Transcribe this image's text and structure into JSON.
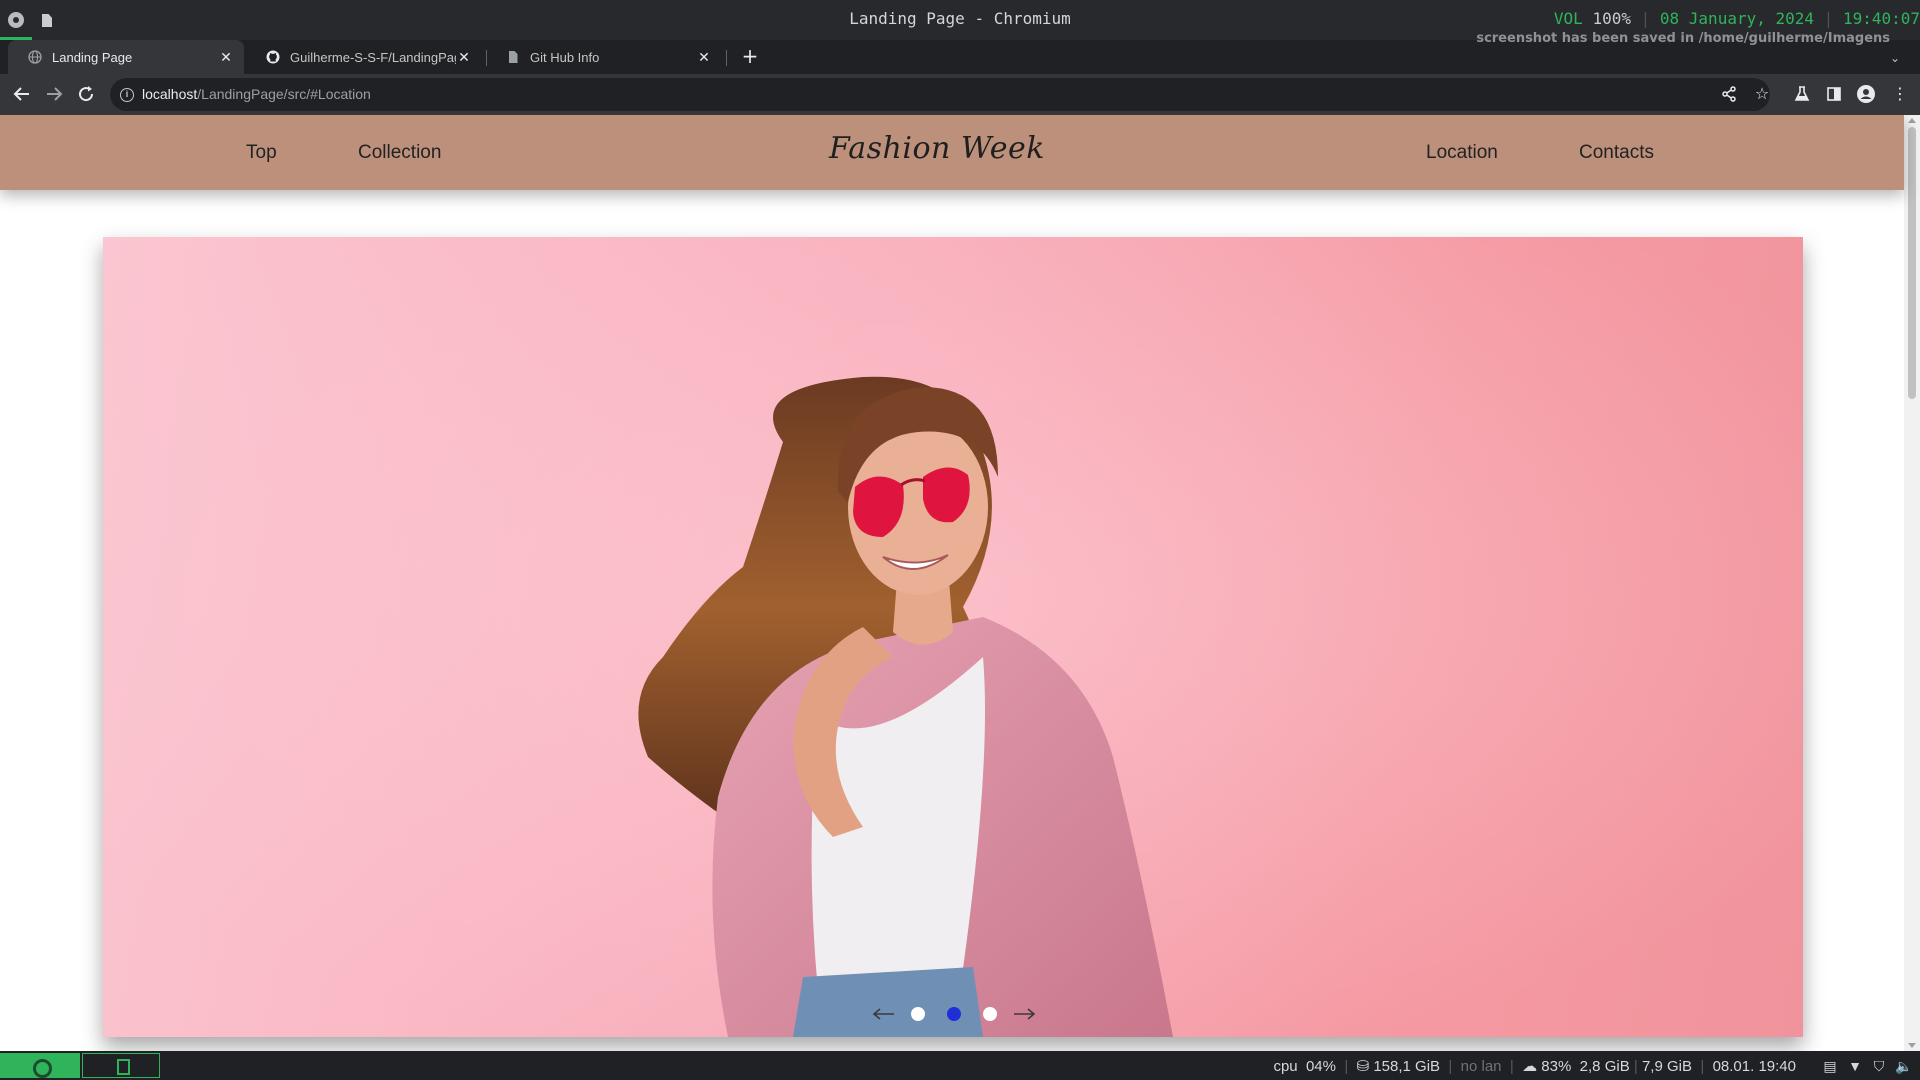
{
  "window": {
    "title": "Landing Page - Chromium",
    "status": {
      "vol_label": "VOL",
      "vol_value": "100%",
      "date": "08 January, 2024",
      "time": "19:40:07"
    },
    "notice": "screenshot has been saved in /home/guilherme/Imagens"
  },
  "browser": {
    "tabs": [
      {
        "label": "Landing Page",
        "favicon": "globe-icon",
        "active": true
      },
      {
        "label": "Guilherme-S-S-F/LandingPag",
        "favicon": "github-icon",
        "active": false
      },
      {
        "label": "Git Hub Info",
        "favicon": "file-icon",
        "active": false
      }
    ],
    "url_host": "localhost",
    "url_path": "/LandingPage/src/#Location"
  },
  "site": {
    "nav_left": [
      "Top",
      "Collection"
    ],
    "logo": "Fashion Week",
    "nav_right": [
      "Location",
      "Contacts"
    ],
    "slider": {
      "slide_count": 3,
      "active_index": 1
    }
  },
  "panel": {
    "cpu_label": "cpu",
    "cpu_value": "04%",
    "disk": "158,1 GiB",
    "lan": "no lan",
    "battery": "83%",
    "mem_used": "2,8 GiB",
    "mem_total": "7,9 GiB",
    "datetime": "08.01. 19:40"
  },
  "colors": {
    "accent": "#2fb45c",
    "nav_bg": "#bd907c",
    "hero_pink": "#f8adba"
  }
}
